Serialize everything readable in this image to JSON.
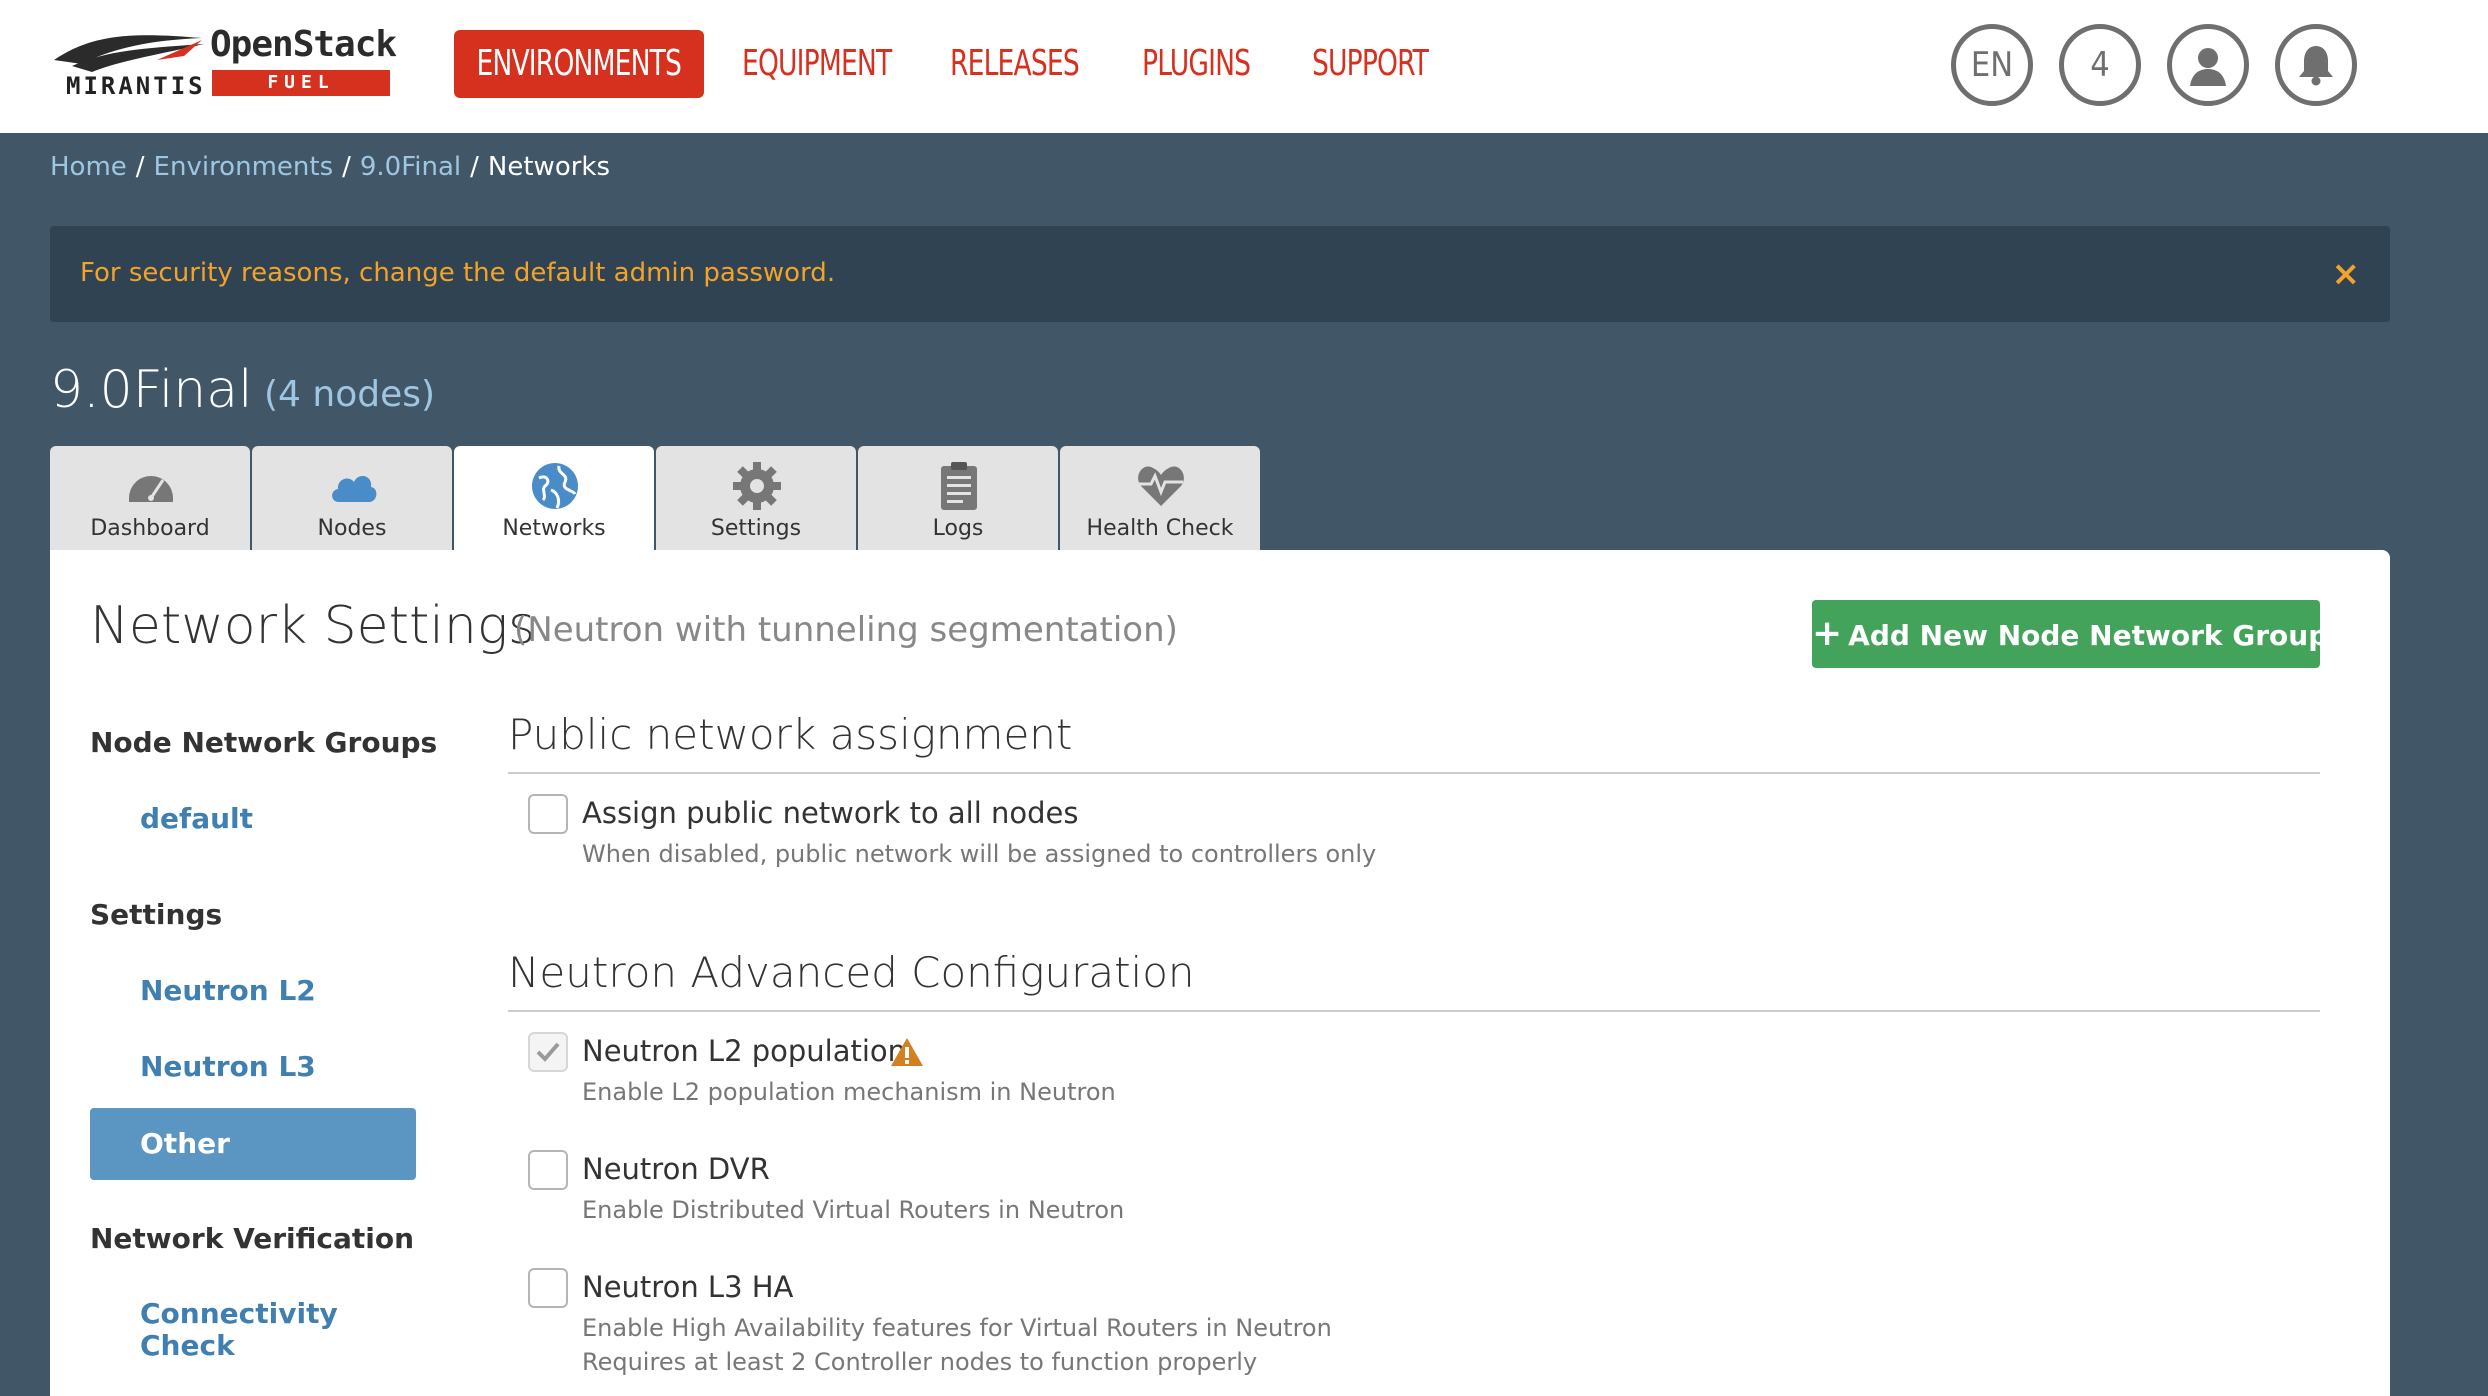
{
  "header": {
    "logo": {
      "brand_top": "OpenStack",
      "brand_bottom": "FUEL",
      "company": "MIRANTIS"
    },
    "nav": [
      {
        "label": "ENVIRONMENTS",
        "active": true
      },
      {
        "label": "EQUIPMENT",
        "active": false
      },
      {
        "label": "RELEASES",
        "active": false
      },
      {
        "label": "PLUGINS",
        "active": false
      },
      {
        "label": "SUPPORT",
        "active": false
      }
    ],
    "language": "EN",
    "notifications_count": "4",
    "icons": [
      "user-icon",
      "bell-icon"
    ]
  },
  "breadcrumb": [
    "Home",
    "Environments",
    "9.0Final",
    "Networks"
  ],
  "alert": {
    "message": "For security reasons, change the default admin password.",
    "close": "×"
  },
  "environment": {
    "name": "9.0Final",
    "nodes": "(4 nodes)"
  },
  "tabs": [
    {
      "label": "Dashboard",
      "icon": "dashboard-gauge-icon",
      "active": false
    },
    {
      "label": "Nodes",
      "icon": "cloud-icon",
      "active": false
    },
    {
      "label": "Networks",
      "icon": "globe-icon",
      "active": true
    },
    {
      "label": "Settings",
      "icon": "gear-icon",
      "active": false
    },
    {
      "label": "Logs",
      "icon": "clipboard-icon",
      "active": false
    },
    {
      "label": "Health Check",
      "icon": "heartbeat-icon",
      "active": false
    }
  ],
  "network_settings": {
    "title": "Network Settings",
    "subtitle": "(Neutron with tunneling segmentation)",
    "add_button": "Add New Node Network Group"
  },
  "sidebar": {
    "groups_heading": "Node Network Groups",
    "groups": [
      "default"
    ],
    "settings_heading": "Settings",
    "settings": [
      "Neutron L2",
      "Neutron L3",
      "Other"
    ],
    "active_setting": "Other",
    "verification_heading": "Network Verification",
    "verification": [
      "Connectivity Check"
    ]
  },
  "sections": {
    "public": {
      "title": "Public network assignment",
      "options": [
        {
          "label": "Assign public network to all nodes",
          "desc": "When disabled, public network will be assigned to controllers only",
          "checked": false
        }
      ]
    },
    "neutron_advanced": {
      "title": "Neutron Advanced Configuration",
      "options": [
        {
          "label": "Neutron L2 population",
          "desc": "Enable L2 population mechanism in Neutron",
          "checked": true,
          "disabled": true,
          "warning": true
        },
        {
          "label": "Neutron DVR",
          "desc": "Enable Distributed Virtual Routers in Neutron",
          "checked": false
        },
        {
          "label": "Neutron L3 HA",
          "desc": "Enable High Availability features for Virtual Routers in Neutron",
          "desc2": "Requires at least 2 Controller nodes to function properly",
          "checked": false
        }
      ]
    }
  },
  "colors": {
    "brand_red": "#d6311e",
    "page_bg": "#415767",
    "alert_bg": "#2f4352",
    "alert_text": "#f2a32b",
    "link_blue": "#3f7fb2",
    "active_side": "#5b95c2",
    "add_green": "#43a35a",
    "warning_orange": "#d4801e"
  }
}
